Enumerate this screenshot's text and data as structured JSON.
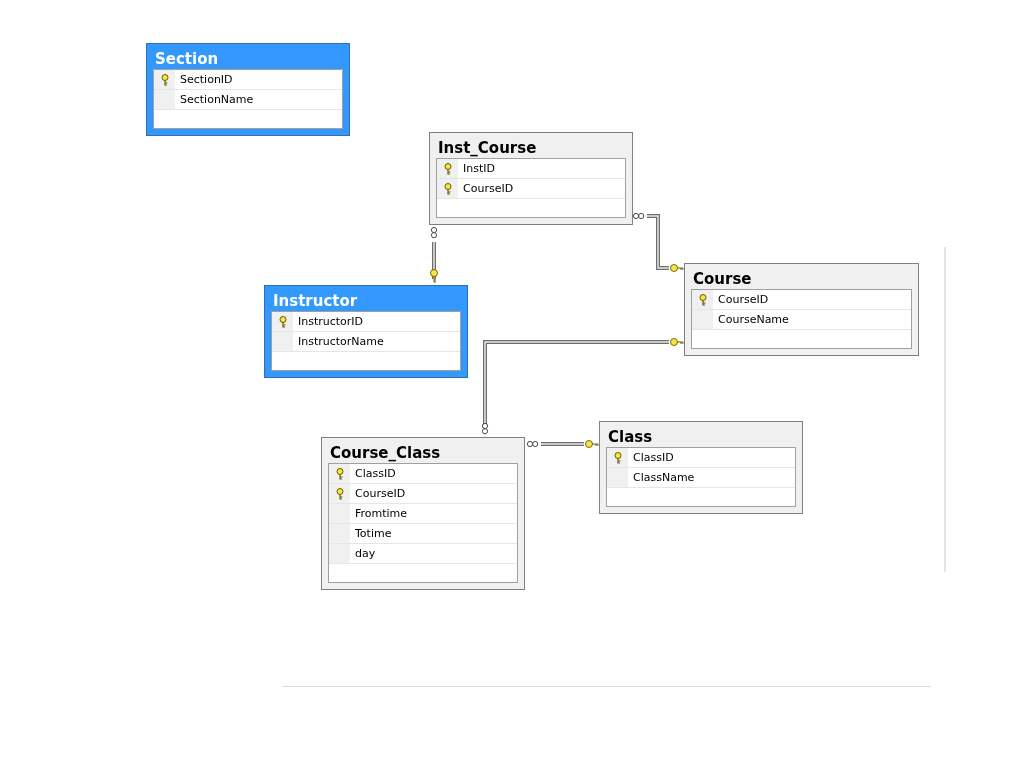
{
  "tables": [
    {
      "name": "Section",
      "selected": true,
      "columns": [
        {
          "name": "SectionID",
          "primary_key": true
        },
        {
          "name": "SectionName",
          "primary_key": false
        }
      ]
    },
    {
      "name": "Inst_Course",
      "selected": false,
      "columns": [
        {
          "name": "InstID",
          "primary_key": true
        },
        {
          "name": "CourseID",
          "primary_key": true
        }
      ]
    },
    {
      "name": "Instructor",
      "selected": true,
      "columns": [
        {
          "name": "InstructorID",
          "primary_key": true
        },
        {
          "name": "InstructorName",
          "primary_key": false
        }
      ]
    },
    {
      "name": "Course",
      "selected": false,
      "columns": [
        {
          "name": "CourseID",
          "primary_key": true
        },
        {
          "name": "CourseName",
          "primary_key": false
        }
      ]
    },
    {
      "name": "Course_Class",
      "selected": false,
      "columns": [
        {
          "name": "ClassID",
          "primary_key": true
        },
        {
          "name": "CourseID",
          "primary_key": true
        },
        {
          "name": "Fromtime",
          "primary_key": false
        },
        {
          "name": "Totime",
          "primary_key": false
        },
        {
          "name": "day",
          "primary_key": false
        }
      ]
    },
    {
      "name": "Class",
      "selected": false,
      "columns": [
        {
          "name": "ClassID",
          "primary_key": true
        },
        {
          "name": "ClassName",
          "primary_key": false
        }
      ]
    }
  ]
}
